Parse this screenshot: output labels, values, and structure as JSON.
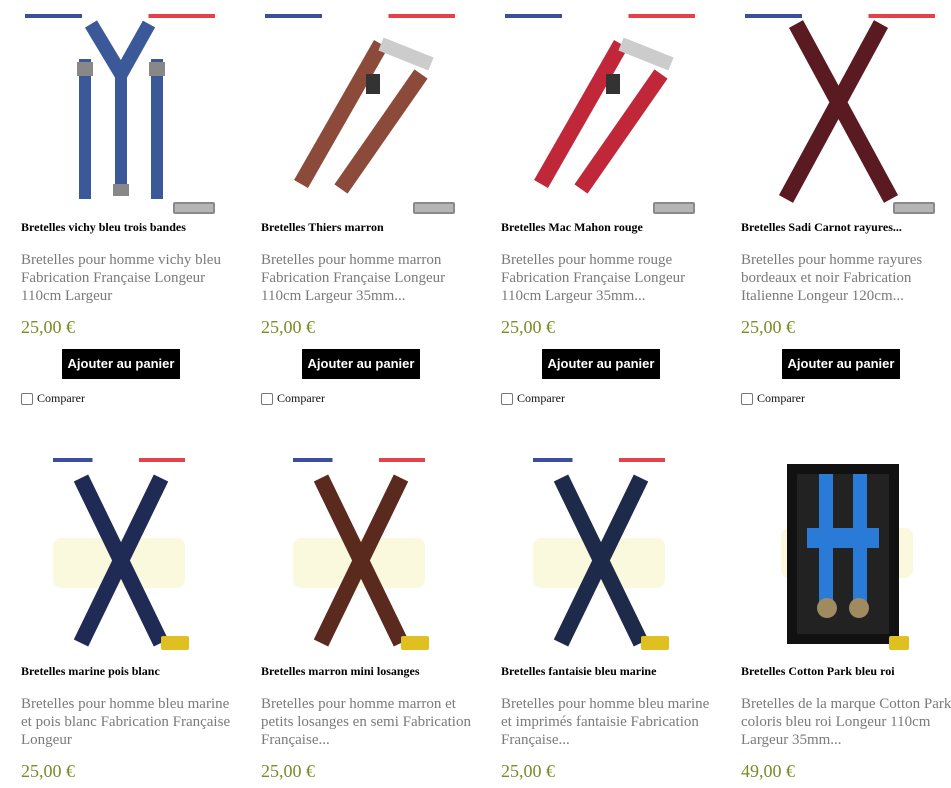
{
  "products": [
    {
      "name": "Bretelles vichy bleu trois bandes",
      "desc": "Bretelles pour homme vichy bleu Fabrication Française Longeur 110cm  Largeur",
      "price": "25,00 €",
      "button": "Ajouter au panier",
      "compare": "Comparer",
      "colors": {
        "strap": "#3b5998",
        "accent": "#2c3f78"
      }
    },
    {
      "name": "Bretelles Thiers marron",
      "desc": "Bretelles pour homme marron Fabrication Française Longeur 110cm  Largeur 35mm...",
      "price": "25,00 €",
      "button": "Ajouter au panier",
      "compare": "Comparer",
      "colors": {
        "strap": "#8b4a3a",
        "accent": "#5a2a20"
      }
    },
    {
      "name": "Bretelles Mac Mahon rouge",
      "desc": "Bretelles pour homme rouge Fabrication Française Longeur 110cm  Largeur 35mm...",
      "price": "25,00 €",
      "button": "Ajouter au panier",
      "compare": "Comparer",
      "colors": {
        "strap": "#c0283a",
        "accent": "#8a1a28"
      }
    },
    {
      "name": "Bretelles Sadi Carnot rayures...",
      "desc": "Bretelles pour homme rayures bordeaux et noir Fabrication Italienne Longeur 120cm...",
      "price": "25,00 €",
      "button": "Ajouter au panier",
      "compare": "Comparer",
      "colors": {
        "strap": "#5a1a22",
        "accent": "#2a0a10"
      }
    },
    {
      "name": "Bretelles marine pois blanc",
      "desc": "Bretelles pour homme bleu marine et pois blanc Fabrication Française Longeur",
      "price": "25,00 €",
      "colors": {
        "strap": "#1f2a55",
        "accent": "#151c3a"
      }
    },
    {
      "name": "Bretelles marron mini losanges",
      "desc": "Bretelles pour homme marron et petits losanges en semi Fabrication Française...",
      "price": "25,00 €",
      "colors": {
        "strap": "#5a2a1e",
        "accent": "#3a1a12"
      }
    },
    {
      "name": "Bretelles fantaisie bleu marine",
      "desc": "Bretelles pour homme bleu marine et imprimés fantaisie Fabrication Française...",
      "price": "25,00 €",
      "colors": {
        "strap": "#1e2a4a",
        "accent": "#111a30"
      }
    },
    {
      "name": "Bretelles Cotton Park bleu roi",
      "desc": "Bretelles de la marque Cotton Park coloris bleu roi  Longeur 110cm  Largeur 35mm...",
      "price": "49,00 €",
      "colors": {
        "strap": "#2a7ad8",
        "accent": "#1a4a9a"
      }
    }
  ],
  "icons": {
    "product_image": "suspenders-image",
    "flag": "french-flag-stripe",
    "checkbox": "checkbox-icon",
    "badge": "brand-badge-icon"
  }
}
